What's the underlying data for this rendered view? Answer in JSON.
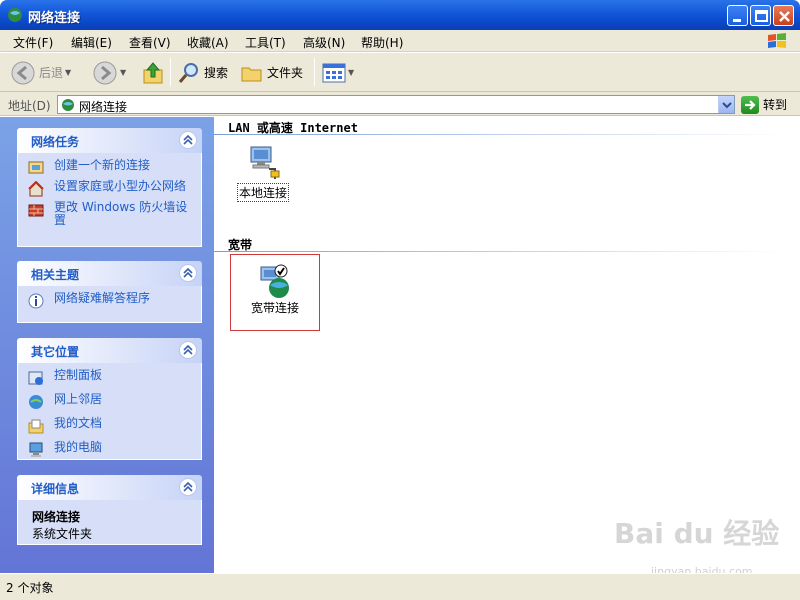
{
  "window": {
    "title": "网络连接"
  },
  "menu": [
    "文件(F)",
    "编辑(E)",
    "查看(V)",
    "收藏(A)",
    "工具(T)",
    "高级(N)",
    "帮助(H)"
  ],
  "toolbar": {
    "back": "后退",
    "search": "搜索",
    "folders": "文件夹"
  },
  "address": {
    "label": "地址(D)",
    "value": "网络连接",
    "go": "转到"
  },
  "left": {
    "network_tasks": {
      "title": "网络任务",
      "items": [
        "创建一个新的连接",
        "设置家庭或小型办公网络",
        "更改 Windows 防火墙设置"
      ]
    },
    "related": {
      "title": "相关主题",
      "items": [
        "网络疑难解答程序"
      ]
    },
    "other": {
      "title": "其它位置",
      "items": [
        "控制面板",
        "网上邻居",
        "我的文档",
        "我的电脑"
      ]
    },
    "details": {
      "title": "详细信息",
      "name": "网络连接",
      "type": "系统文件夹"
    }
  },
  "groups": {
    "lan": {
      "title": "LAN 或高速 Internet",
      "item": "本地连接"
    },
    "broadband": {
      "title": "宽带",
      "item": "宽带连接"
    }
  },
  "status": {
    "text": "2 个对象"
  },
  "watermark": {
    "logo": "Bai du 经验",
    "url": "jingyan.baidu.com"
  },
  "colors": {
    "titlebar": "#0a46c4",
    "panel_bg": "#d6dff7",
    "link": "#215dc6",
    "highlight": "#d0393a"
  }
}
